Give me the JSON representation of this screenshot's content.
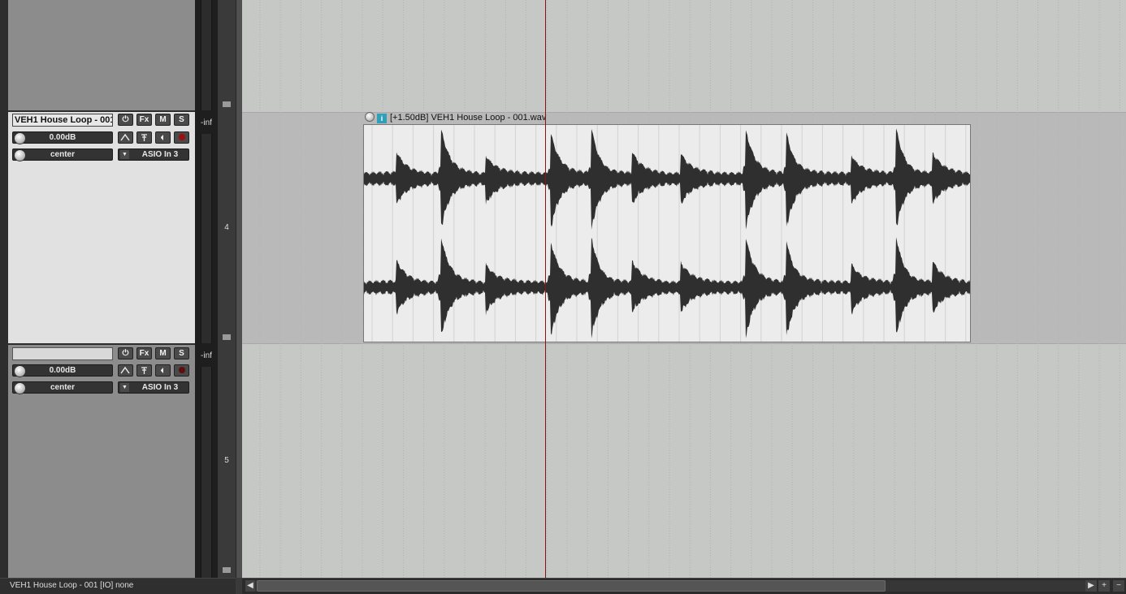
{
  "tracks": [
    {
      "number": "4",
      "name": "VEH1 House Loop - 001",
      "volume": "0.00dB",
      "pan": "center",
      "input": "ASIO In 3",
      "meter": "-inf",
      "buttons": {
        "power": "⏻",
        "fx": "Fx",
        "mute": "M",
        "solo": "S"
      }
    },
    {
      "number": "5",
      "name": "",
      "volume": "0.00dB",
      "pan": "center",
      "input": "ASIO In 3",
      "meter": "-inf",
      "buttons": {
        "power": "⏻",
        "fx": "Fx",
        "mute": "M",
        "solo": "S"
      }
    }
  ],
  "item": {
    "label": "[+1.50dB] VEH1 House Loop - 001.wav",
    "info_icon": "i"
  },
  "status": "VEH1 House Loop - 001 [IO] none",
  "scrollbar": {
    "left": "◀",
    "right": "▶",
    "plus": "+",
    "minus": "−"
  },
  "colors": {
    "playhead": "#8a1414",
    "waveform": "#2f2f2f",
    "item_bg": "#ececec",
    "selected_tcp": "#e1e1e1"
  }
}
